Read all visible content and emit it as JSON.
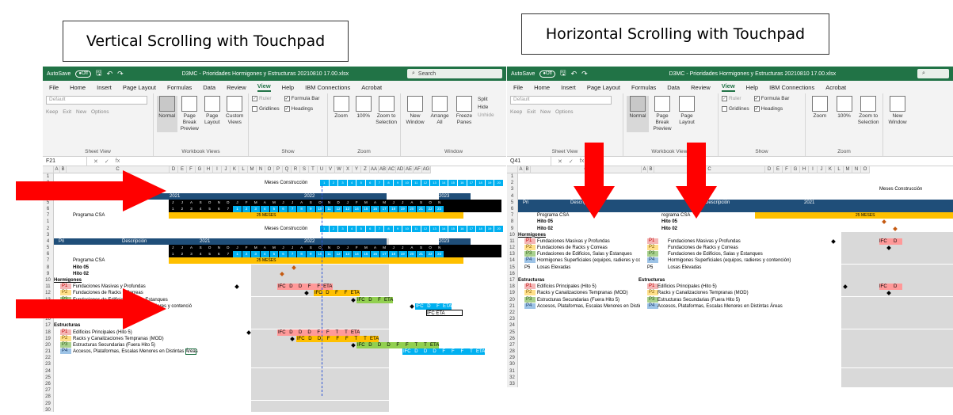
{
  "captions": {
    "left": "Vertical Scrolling with Touchpad",
    "right": "Horizontal Scrolling with Touchpad"
  },
  "excel": {
    "autosave": "AutoSave",
    "toggle": "Off",
    "filename": "D3MC - Prioridades Hormigones y Estructuras 20210810 17.00.xlsx",
    "search": "Search",
    "menu": [
      "File",
      "Home",
      "Insert",
      "Page Layout",
      "Formulas",
      "Data",
      "Review",
      "View",
      "Help",
      "IBM Connections",
      "Acrobat"
    ],
    "active_menu": "View",
    "ribbon": {
      "default_dropdown": "Default",
      "keep": "Keep",
      "exit": "Exit",
      "new": "New",
      "options": "Options",
      "sheet_view": "Sheet View",
      "normal": "Normal",
      "page_break": "Page Break Preview",
      "page_layout": "Page Layout",
      "custom_views": "Custom Views",
      "workbook_views": "Workbook Views",
      "ruler": "Ruler",
      "formula_bar": "Formula Bar",
      "gridlines": "Gridlines",
      "headings": "Headings",
      "show": "Show",
      "zoom": "Zoom",
      "zoom100": "100%",
      "zoom_sel": "Zoom to Selection",
      "zoom_group": "Zoom",
      "new_window": "New Window",
      "arrange_all": "Arrange All",
      "freeze": "Freeze Panes",
      "split": "Split",
      "hide": "Hide",
      "unhide": "Unhide",
      "window": "Window"
    },
    "namebox_left": "F21",
    "namebox_right": "Q41",
    "fx": "fx"
  },
  "sheet": {
    "meses": "Meses Construcción",
    "pri": "Pri",
    "descripcion": "Descripción",
    "years": [
      "2021",
      "2022",
      "2023"
    ],
    "months": [
      "J",
      "J",
      "A",
      "S",
      "O",
      "N",
      "D",
      "J",
      "F",
      "M",
      "A",
      "M",
      "J",
      "J",
      "A",
      "S",
      "O",
      "N",
      "D",
      "J",
      "F",
      "M",
      "A",
      "M",
      "J",
      "J",
      "A",
      "S",
      "O",
      "N"
    ],
    "programa": "Programa CSA",
    "programa_right": "rograma CSA",
    "meses_label": "25 MESES",
    "hito05": "Hito 05",
    "hito02": "Hito 02",
    "hormigones": "Hormigones",
    "estructuras": "Estructuras",
    "horm_items": [
      {
        "p": "P1",
        "t": "Fundaciones Masivas y Profundas"
      },
      {
        "p": "P2",
        "t": "Fundaciones de Racks y Correas"
      },
      {
        "p": "P3",
        "t": "Fundaciones de Edificios, Salas y Estanques"
      },
      {
        "p": "P4",
        "t": "Hormigones Superficiales (equipos, radieres y contención)"
      },
      {
        "p": "P5",
        "t": "Losas Elevadas"
      }
    ],
    "est_items": [
      {
        "p": "P1",
        "t": "Edificios Principales (Hito 5)"
      },
      {
        "p": "P2",
        "t": "Racks y Canalizaciones Tempranas (MOD)"
      },
      {
        "p": "P3",
        "t": "Estructuras Secundarias (Fuera Hito 5)"
      },
      {
        "p": "P4",
        "t": "Accesos, Plataformas, Escalas Menores en Distintas Áreas"
      }
    ],
    "horm_item4_partial": "Hormigones Superficiales (equipos, radieres y contención)",
    "bar_labels": {
      "ifc": "IFC",
      "d": "D",
      "f": "F",
      "t": "T",
      "eta": "ETA"
    }
  },
  "colors": {
    "excel_green": "#217346",
    "header_navy": "#1f4e79",
    "arrow_red": "#ff0000"
  }
}
